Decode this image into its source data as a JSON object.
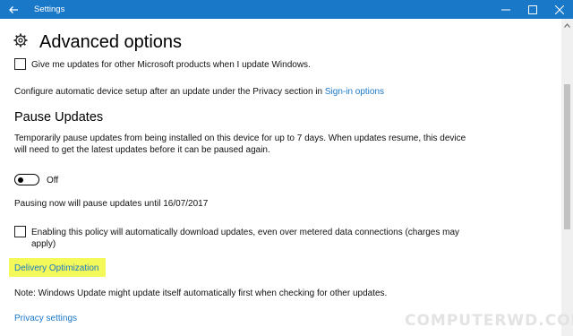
{
  "window": {
    "title": "Settings",
    "accent": "#1a78c8",
    "controls": [
      "minimize-icon",
      "maximize-icon",
      "close-icon"
    ]
  },
  "page": {
    "title": "Advanced options",
    "icon": "gear-icon"
  },
  "options": {
    "other_products_checkbox": {
      "label": "Give me updates for other Microsoft products when I update Windows.",
      "checked": false
    },
    "device_setup_text": "Configure automatic device setup after an update under the Privacy section in",
    "signin_link": "Sign-in options"
  },
  "pause_updates": {
    "heading": "Pause Updates",
    "description_line1": "Temporarily pause updates from being installed on this device for up to 7 days. When updates resume, this device",
    "description_line2": "will need to get the latest updates before it can be paused again.",
    "toggle_state": "Off",
    "pause_until_text": "Pausing now will pause updates until 16/07/2017"
  },
  "metered": {
    "label_line1": "Enabling this policy will automatically download updates, even over metered data connections (charges may",
    "label_line2": "apply)",
    "checked": false
  },
  "delivery_optimization": {
    "link": "Delivery Optimization",
    "highlight_color": "#f4f95a"
  },
  "note": "Note: Windows Update might update itself automatically first when checking for other updates.",
  "privacy_link": "Privacy settings",
  "watermark": "COMPUTERWD.COM"
}
